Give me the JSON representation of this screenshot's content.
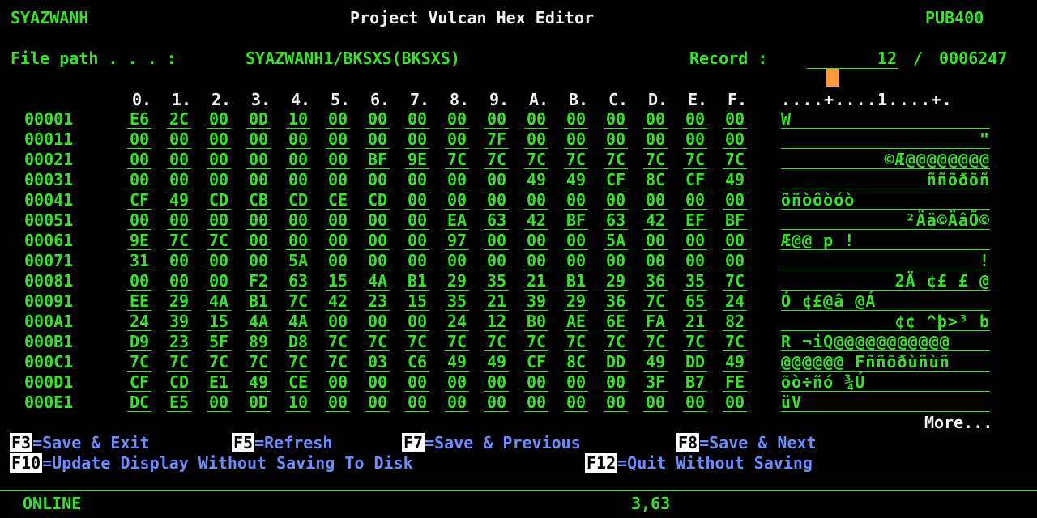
{
  "header": {
    "user": "SYAZWANH",
    "title": "Project Vulcan Hex Editor",
    "system": "PUB400"
  },
  "file": {
    "label": "File path . . . :",
    "path": "SYAZWANH1/BKSXS(BKSXS)",
    "record_label": "Record :",
    "record_value": "12",
    "record_sep": "/",
    "record_total": "0006247"
  },
  "columns": [
    "0.",
    "1.",
    "2.",
    "3.",
    "4.",
    "5.",
    "6.",
    "7.",
    "8.",
    "9.",
    "A.",
    "B.",
    "C.",
    "D.",
    "E.",
    "F."
  ],
  "ruler": "....+....1....+.",
  "rows": [
    {
      "addr": "00001",
      "hex": [
        "E6",
        "2C",
        "00",
        "0D",
        "10",
        "00",
        "00",
        "00",
        "00",
        "00",
        "00",
        "00",
        "00",
        "00",
        "00",
        "00"
      ],
      "text": "W"
    },
    {
      "addr": "00011",
      "hex": [
        "00",
        "00",
        "00",
        "00",
        "00",
        "00",
        "00",
        "00",
        "00",
        "7F",
        "00",
        "00",
        "00",
        "00",
        "00",
        "00"
      ],
      "text": "\""
    },
    {
      "addr": "00021",
      "hex": [
        "00",
        "00",
        "00",
        "00",
        "00",
        "00",
        "BF",
        "9E",
        "7C",
        "7C",
        "7C",
        "7C",
        "7C",
        "7C",
        "7C",
        "7C"
      ],
      "text": "©Æ@@@@@@@@"
    },
    {
      "addr": "00031",
      "hex": [
        "00",
        "00",
        "00",
        "00",
        "00",
        "00",
        "00",
        "00",
        "00",
        "00",
        "49",
        "49",
        "CF",
        "8C",
        "CF",
        "49"
      ],
      "text": "ññõðõñ"
    },
    {
      "addr": "00041",
      "hex": [
        "CF",
        "49",
        "CD",
        "CB",
        "CD",
        "CE",
        "CD",
        "00",
        "00",
        "00",
        "00",
        "00",
        "00",
        "00",
        "00",
        "00"
      ],
      "text": "õñòôòóò"
    },
    {
      "addr": "00051",
      "hex": [
        "00",
        "00",
        "00",
        "00",
        "00",
        "00",
        "00",
        "00",
        "EA",
        "63",
        "42",
        "BF",
        "63",
        "42",
        "EF",
        "BF"
      ],
      "text": "²Ää©ÄâÕ©"
    },
    {
      "addr": "00061",
      "hex": [
        "9E",
        "7C",
        "7C",
        "00",
        "00",
        "00",
        "00",
        "00",
        "97",
        "00",
        "00",
        "00",
        "5A",
        "00",
        "00",
        "00"
      ],
      "text": "Æ@@      p    !   "
    },
    {
      "addr": "00071",
      "hex": [
        "31",
        "00",
        "00",
        "00",
        "5A",
        "00",
        "00",
        "00",
        "00",
        "00",
        "00",
        "00",
        "00",
        "00",
        "00",
        "00"
      ],
      "text": "    !           "
    },
    {
      "addr": "00081",
      "hex": [
        "00",
        "00",
        "00",
        "F2",
        "63",
        "15",
        "4A",
        "B1",
        "29",
        "35",
        "21",
        "B1",
        "29",
        "36",
        "35",
        "7C"
      ],
      "text": "   2Ä ¢£    £   @"
    },
    {
      "addr": "00091",
      "hex": [
        "EE",
        "29",
        "4A",
        "B1",
        "7C",
        "42",
        "23",
        "15",
        "35",
        "21",
        "39",
        "29",
        "36",
        "7C",
        "65",
        "24"
      ],
      "text": "Ó ¢£@â       @Á "
    },
    {
      "addr": "000A1",
      "hex": [
        "24",
        "39",
        "15",
        "4A",
        "4A",
        "00",
        "00",
        "00",
        "24",
        "12",
        "B0",
        "AE",
        "6E",
        "FA",
        "21",
        "82"
      ],
      "text": "  ¢¢        ^þ>³ b"
    },
    {
      "addr": "000B1",
      "hex": [
        "D9",
        "23",
        "5F",
        "89",
        "D8",
        "7C",
        "7C",
        "7C",
        "7C",
        "7C",
        "7C",
        "7C",
        "7C",
        "7C",
        "7C",
        "7C"
      ],
      "text": "R ¬iQ@@@@@@@@@@@"
    },
    {
      "addr": "000C1",
      "hex": [
        "7C",
        "7C",
        "7C",
        "7C",
        "7C",
        "7C",
        "03",
        "C6",
        "49",
        "49",
        "CF",
        "8C",
        "DD",
        "49",
        "DD",
        "49"
      ],
      "text": "@@@@@@ Fññõðùñùñ"
    },
    {
      "addr": "000D1",
      "hex": [
        "CF",
        "CD",
        "E1",
        "49",
        "CE",
        "00",
        "00",
        "00",
        "00",
        "00",
        "00",
        "00",
        "00",
        "3F",
        "B7",
        "FE"
      ],
      "text": "õò÷ñó          ¾Ú"
    },
    {
      "addr": "000E1",
      "hex": [
        "DC",
        "E5",
        "00",
        "0D",
        "10",
        "00",
        "00",
        "00",
        "00",
        "00",
        "00",
        "00",
        "00",
        "00",
        "00",
        "00"
      ],
      "text": "üV"
    }
  ],
  "more": "More...",
  "fkeys": [
    {
      "key": "F3",
      "label": "=Save & Exit"
    },
    {
      "key": "F5",
      "label": "=Refresh"
    },
    {
      "key": "F7",
      "label": "=Save & Previous"
    },
    {
      "key": "F8",
      "label": "=Save & Next"
    },
    {
      "key": "F10",
      "label": "=Update Display Without Saving To Disk"
    },
    {
      "key": "F12",
      "label": "=Quit Without Saving"
    }
  ],
  "status": {
    "state": "ONLINE",
    "cursor": "3,63"
  }
}
